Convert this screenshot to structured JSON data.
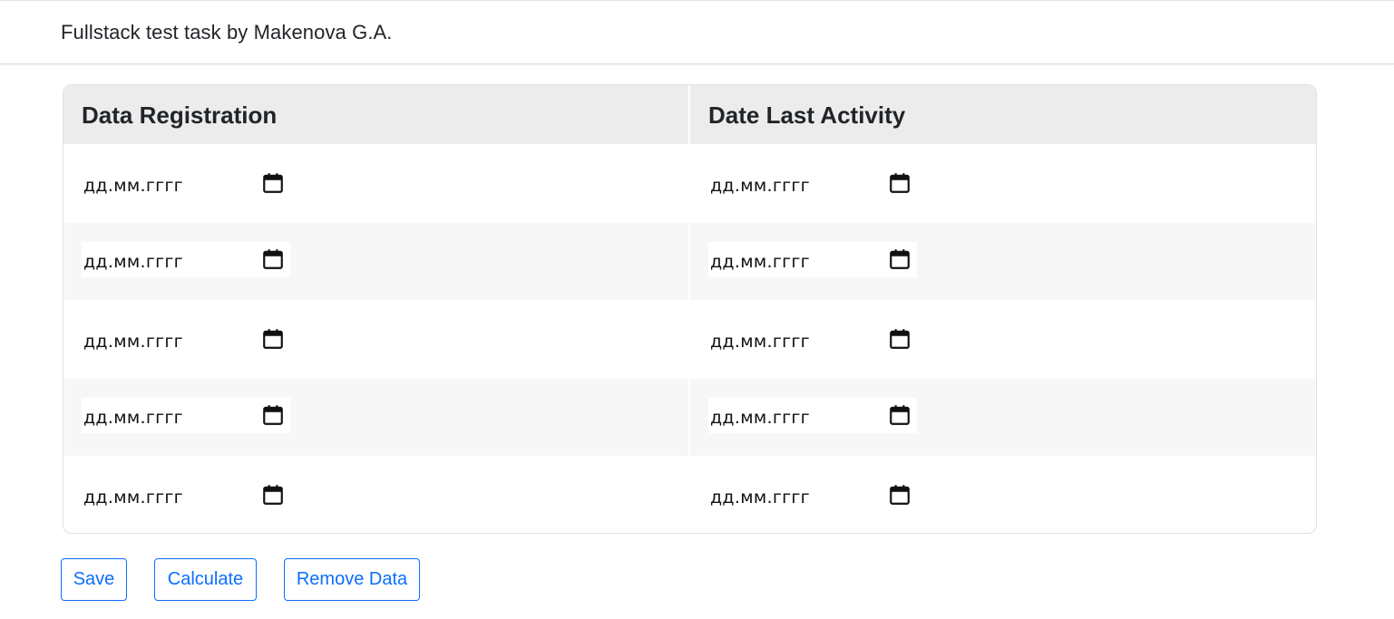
{
  "navbar": {
    "brand": "Fullstack test task by Makenova G.A."
  },
  "table": {
    "columns": [
      "Data Registration",
      "Date Last Activity"
    ],
    "rows": [
      {
        "registration_placeholder": "дд.мм.гггг",
        "activity_placeholder": "дд.мм.гггг"
      },
      {
        "registration_placeholder": "дд.мм.гггг",
        "activity_placeholder": "дд.мм.гггг"
      },
      {
        "registration_placeholder": "дд.мм.гггг",
        "activity_placeholder": "дд.мм.гггг"
      },
      {
        "registration_placeholder": "дд.мм.гггг",
        "activity_placeholder": "дд.мм.гггг"
      },
      {
        "registration_placeholder": "дд.мм.гггг",
        "activity_placeholder": "дд.мм.гггг"
      }
    ],
    "input_icon": "calendar-icon"
  },
  "buttons": {
    "save": "Save",
    "calculate": "Calculate",
    "remove": "Remove Data"
  },
  "colors": {
    "accent": "#0d6efd",
    "header_bg": "#ececec",
    "stripe_bg": "#f7f7f7"
  }
}
